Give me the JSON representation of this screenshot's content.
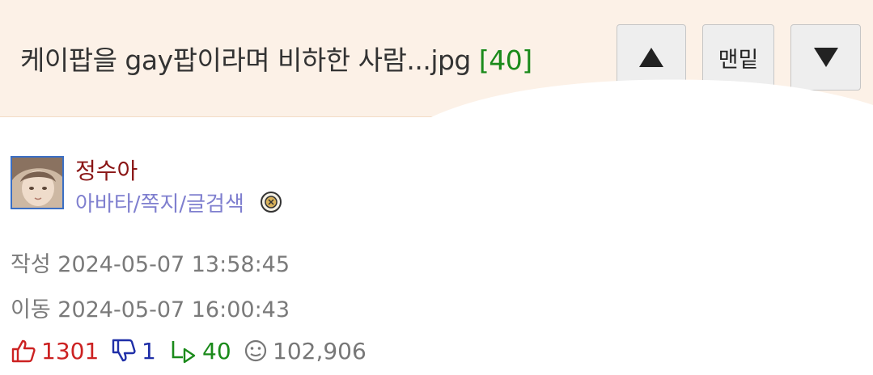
{
  "header": {
    "title": "케이팝을 gay팝이라며 비하한 사람...jpg",
    "comment_count": "[40]",
    "up_icon": "triangle-up-icon",
    "bottom_label": "맨밑",
    "down_icon": "triangle-down-icon"
  },
  "author": {
    "name": "정수아",
    "links": "아바타/쪽지/글검색",
    "badge_icon": "member-badge-icon"
  },
  "meta": {
    "created": "작성 2024-05-07 13:58:45",
    "moved": "이동 2024-05-07 16:00:43"
  },
  "stats": {
    "upvotes": "1301",
    "downvotes": "1",
    "replies": "40",
    "views": "102,906"
  },
  "colors": {
    "header_bg": "#fcf1e7",
    "comment_count": "#1a8a1a",
    "author_name": "#8a1515",
    "author_links": "#7f7fcf",
    "upvote": "#cc2222",
    "downvote": "#1f2fa8",
    "reply": "#1a8a1a"
  }
}
